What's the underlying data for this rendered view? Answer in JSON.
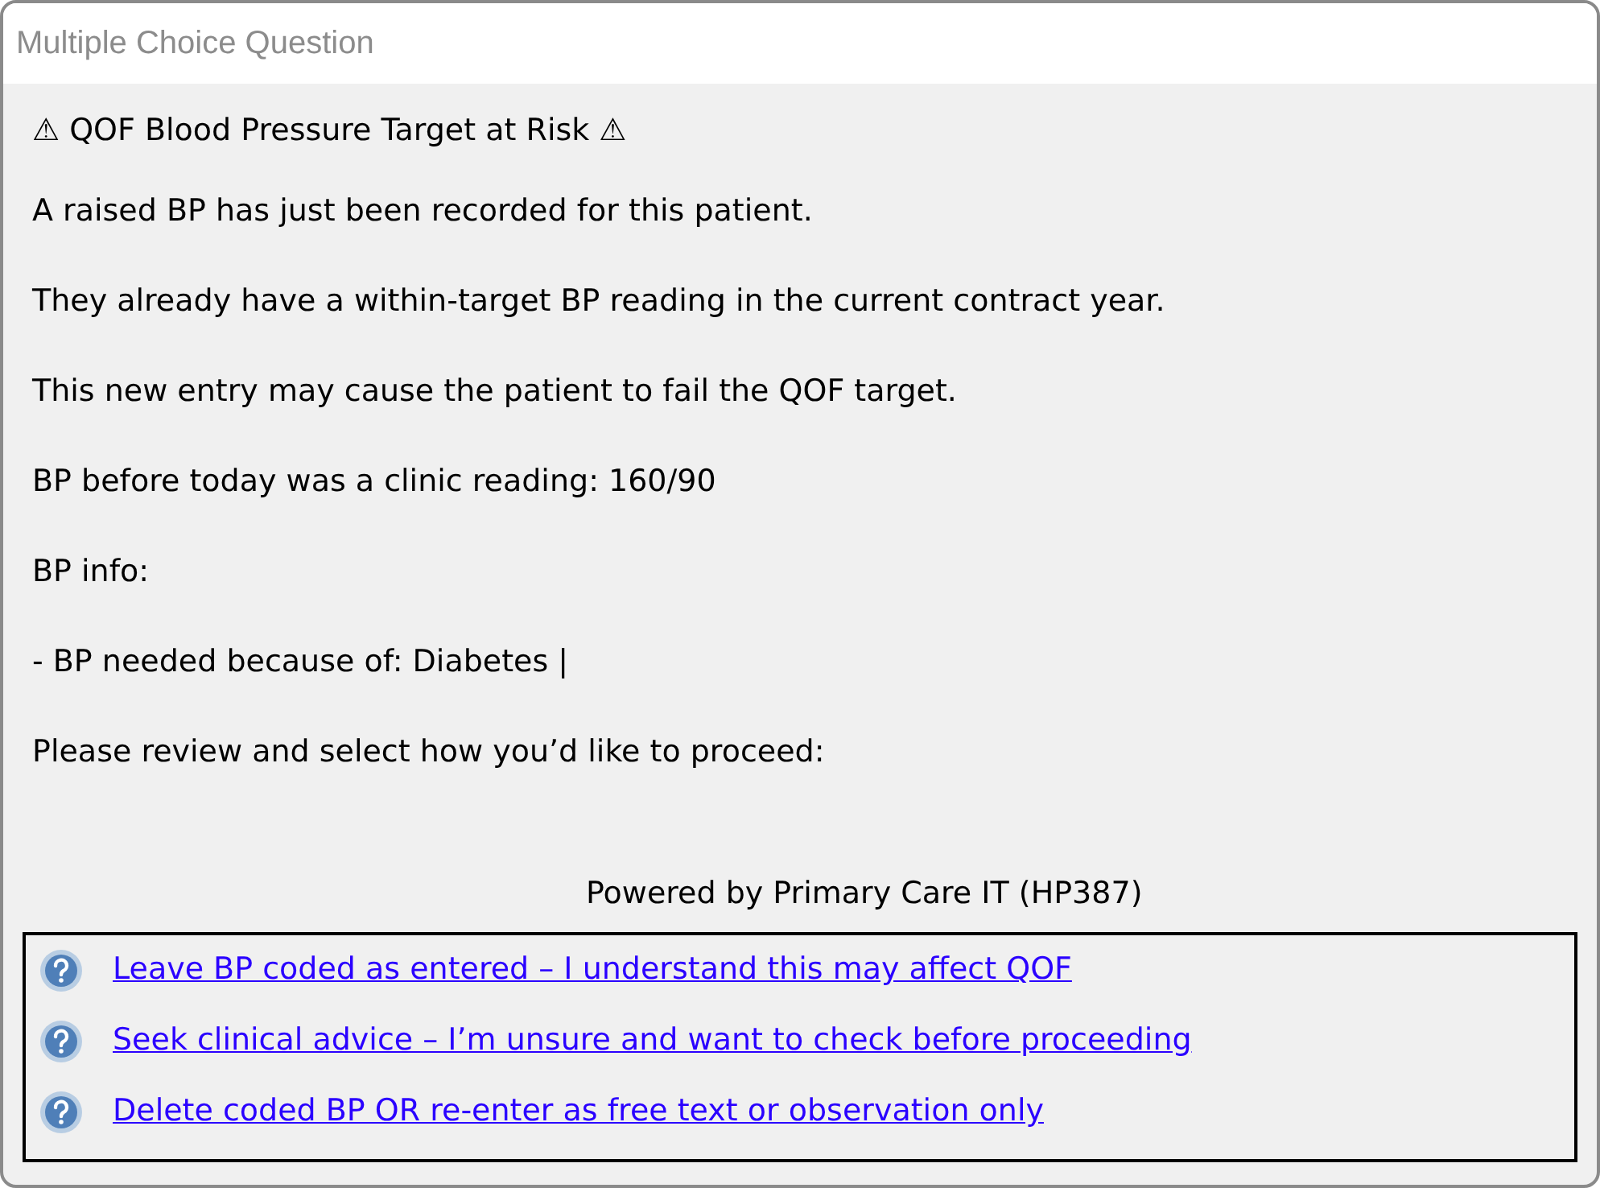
{
  "window": {
    "title": "Multiple Choice Question"
  },
  "heading": "⚠ QOF Blood Pressure Target at Risk ⚠",
  "paragraphs": [
    "A raised BP has just been recorded for this patient.",
    "They already have a within-target BP reading in the current contract year.",
    "This new entry may cause the patient to fail the QOF target.",
    "BP before today was a clinic reading: 160/90",
    "BP info:",
    "- BP needed because of: Diabetes |",
    "Please review and select how you’d like to proceed:"
  ],
  "footer": "Powered by Primary Care IT (HP387)",
  "options": [
    "Leave BP coded as entered – I understand this may affect QOF",
    "Seek clinical advice – I’m unsure and want to check before proceeding",
    "Delete coded BP OR re-enter as free text or observation only"
  ]
}
